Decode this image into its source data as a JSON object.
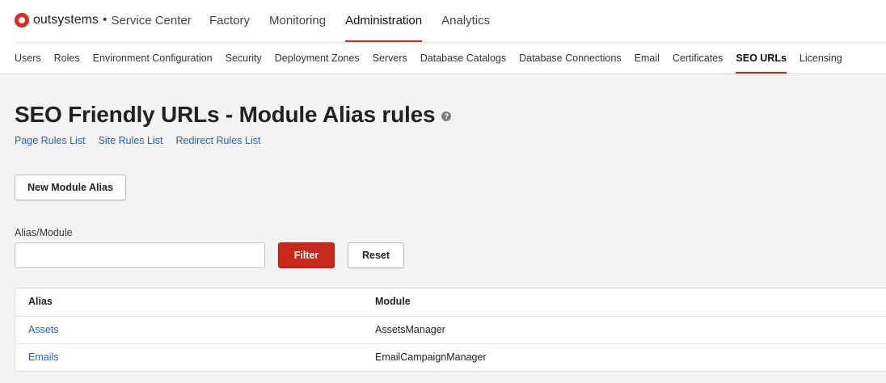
{
  "brand": {
    "name": "outsystems",
    "separator": "•",
    "product": "Service Center",
    "accent": "#e4291a"
  },
  "main_nav": [
    {
      "label": "Factory",
      "active": false
    },
    {
      "label": "Monitoring",
      "active": false
    },
    {
      "label": "Administration",
      "active": true
    },
    {
      "label": "Analytics",
      "active": false
    }
  ],
  "sub_nav": [
    {
      "label": "Users"
    },
    {
      "label": "Roles"
    },
    {
      "label": "Environment Configuration"
    },
    {
      "label": "Security"
    },
    {
      "label": "Deployment Zones"
    },
    {
      "label": "Servers"
    },
    {
      "label": "Database Catalogs"
    },
    {
      "label": "Database Connections"
    },
    {
      "label": "Email"
    },
    {
      "label": "Certificates"
    },
    {
      "label": "SEO URLs",
      "active": true
    },
    {
      "label": "Licensing"
    }
  ],
  "page": {
    "title": "SEO Friendly URLs - Module Alias rules",
    "help_icon": "question-circle-icon",
    "links": [
      "Page Rules List",
      "Site Rules List",
      "Redirect Rules List"
    ],
    "new_button": "New Module Alias"
  },
  "filter": {
    "label": "Alias/Module",
    "value": "",
    "placeholder": "",
    "filter_button": "Filter",
    "reset_button": "Reset"
  },
  "table": {
    "columns": [
      "Alias",
      "Module"
    ],
    "rows": [
      {
        "alias": "Assets",
        "module": "AssetsManager"
      },
      {
        "alias": "Emails",
        "module": "EmailCampaignManager"
      }
    ]
  },
  "colors": {
    "primary": "#c8291a",
    "link": "#2660b8",
    "background": "#f4f4f5"
  }
}
